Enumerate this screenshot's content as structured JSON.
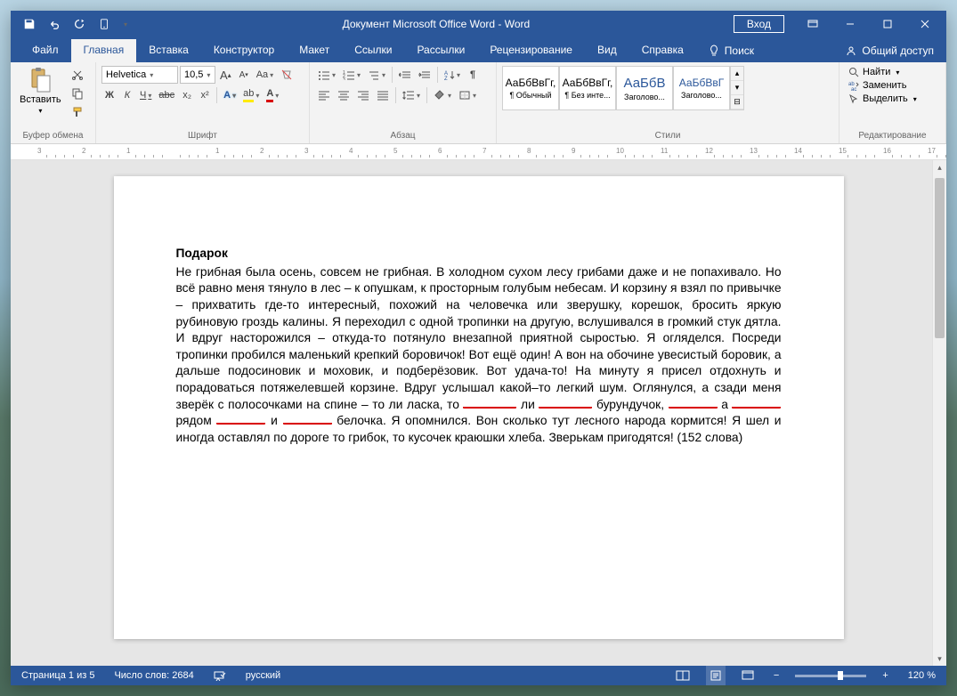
{
  "titlebar": {
    "title": "Документ Microsoft Office Word  -  Word",
    "signin": "Вход"
  },
  "tabs": {
    "file": "Файл",
    "items": [
      "Главная",
      "Вставка",
      "Конструктор",
      "Макет",
      "Ссылки",
      "Рассылки",
      "Рецензирование",
      "Вид",
      "Справка"
    ],
    "active_index": 0,
    "search": "Поиск",
    "share": "Общий доступ"
  },
  "ribbon": {
    "clipboard": {
      "paste": "Вставить",
      "label": "Буфер обмена"
    },
    "font": {
      "name": "Helvetica",
      "size": "10,5",
      "bold": "Ж",
      "italic": "К",
      "underline": "Ч",
      "strike": "abc",
      "sub": "x₂",
      "sup": "x²",
      "label": "Шрифт"
    },
    "paragraph": {
      "label": "Абзац"
    },
    "styles": {
      "items": [
        {
          "preview": "АаБбВвГг,",
          "name": "¶ Обычный"
        },
        {
          "preview": "АаБбВвГг,",
          "name": "¶ Без инте..."
        },
        {
          "preview": "АаБбВ",
          "name": "Заголово..."
        },
        {
          "preview": "АаБбВвГ",
          "name": "Заголово..."
        }
      ],
      "label": "Стили"
    },
    "editing": {
      "find": "Найти",
      "replace": "Заменить",
      "select": "Выделить",
      "label": "Редактирование"
    }
  },
  "ruler": {
    "marks": [
      "3",
      "2",
      "1",
      "",
      "1",
      "2",
      "3",
      "4",
      "5",
      "6",
      "7",
      "8",
      "9",
      "10",
      "11",
      "12",
      "13",
      "14",
      "15",
      "16",
      "17"
    ]
  },
  "document": {
    "title": "Подарок",
    "body_pre": "Не грибная была осень, совсем не грибная. В холодном сухом лесу грибами даже и не попахивало. Но всё равно меня тянуло в лес – к опушкам, к просторным голубым небесам. И корзину я взял по привычке – прихватить где-то интересный, похожий на человечка или зверушку, корешок, бросить яркую рубиновую гроздь калины. Я переходил с одной тропинки на другую, вслушивался в громкий стук дятла. И вдруг насторожился – откуда-то потянуло внезапной приятной сыростью. Я огляделся. Посреди тропинки пробился маленький крепкий боровичок! Вот ещё один! А вон на обочине увесистый боровик, а дальше подосиновик и моховик, и подберёзовик. Вот удача-то! На минуту я присел отдохнуть и порадоваться потяжелевшей корзине. Вдруг услышал какой–то легкий шум. Оглянулся, а сзади меня зверёк с полосочками на спине – то ли ласка, то ",
    "w1": "ли",
    "w2": "бурундучок,",
    "w3": "а",
    "w4": "рядом",
    "w5": "и",
    "w6": "белочка.",
    "body_post": " Я опомнился. Вон сколько тут лесного народа кормится! Я шел и иногда оставлял по дороге то грибок, то кусочек краюшки хлеба. Зверькам пригодятся! (152 слова)"
  },
  "statusbar": {
    "page": "Страница 1 из 5",
    "words": "Число слов: 2684",
    "lang": "русский",
    "zoom": "120 %"
  }
}
